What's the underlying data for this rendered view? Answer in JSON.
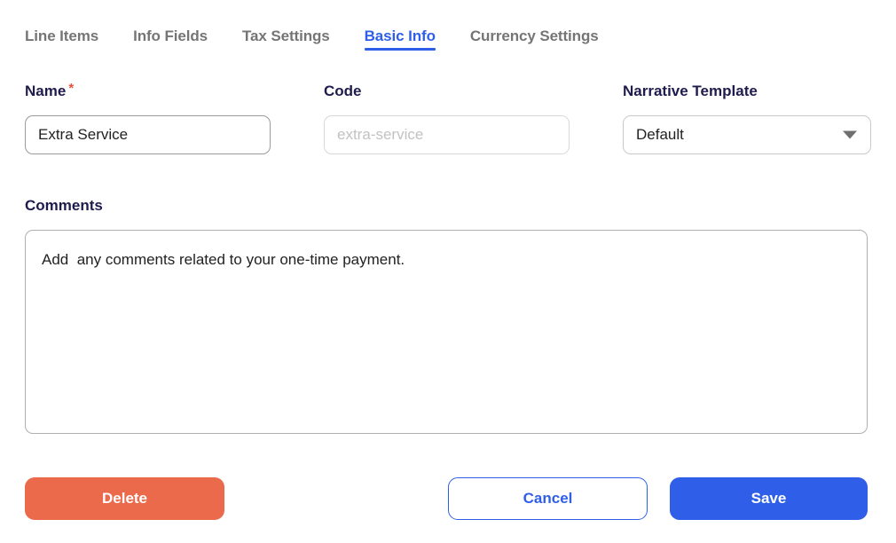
{
  "tabs": [
    {
      "label": "Line Items",
      "active": false
    },
    {
      "label": "Info Fields",
      "active": false
    },
    {
      "label": "Tax Settings",
      "active": false
    },
    {
      "label": "Basic Info",
      "active": true
    },
    {
      "label": "Currency Settings",
      "active": false
    }
  ],
  "form": {
    "name": {
      "label": "Name",
      "required_marker": "*",
      "value": "Extra Service",
      "placeholder": ""
    },
    "code": {
      "label": "Code",
      "value": "",
      "placeholder": "extra-service"
    },
    "narrative_template": {
      "label": "Narrative Template",
      "selected": "Default",
      "caret_icon": "chevron-down-icon"
    },
    "comments": {
      "label": "Comments",
      "value": "Add  any comments related to your one-time payment.",
      "placeholder": ""
    }
  },
  "footer": {
    "delete_label": "Delete",
    "cancel_label": "Cancel",
    "save_label": "Save"
  },
  "colors": {
    "accent_blue": "#2F5FE8",
    "delete_coral": "#EC6A4C",
    "label_navy": "#1F1B4D",
    "required_red": "#E8503A",
    "inactive_tab_gray": "#757575"
  }
}
